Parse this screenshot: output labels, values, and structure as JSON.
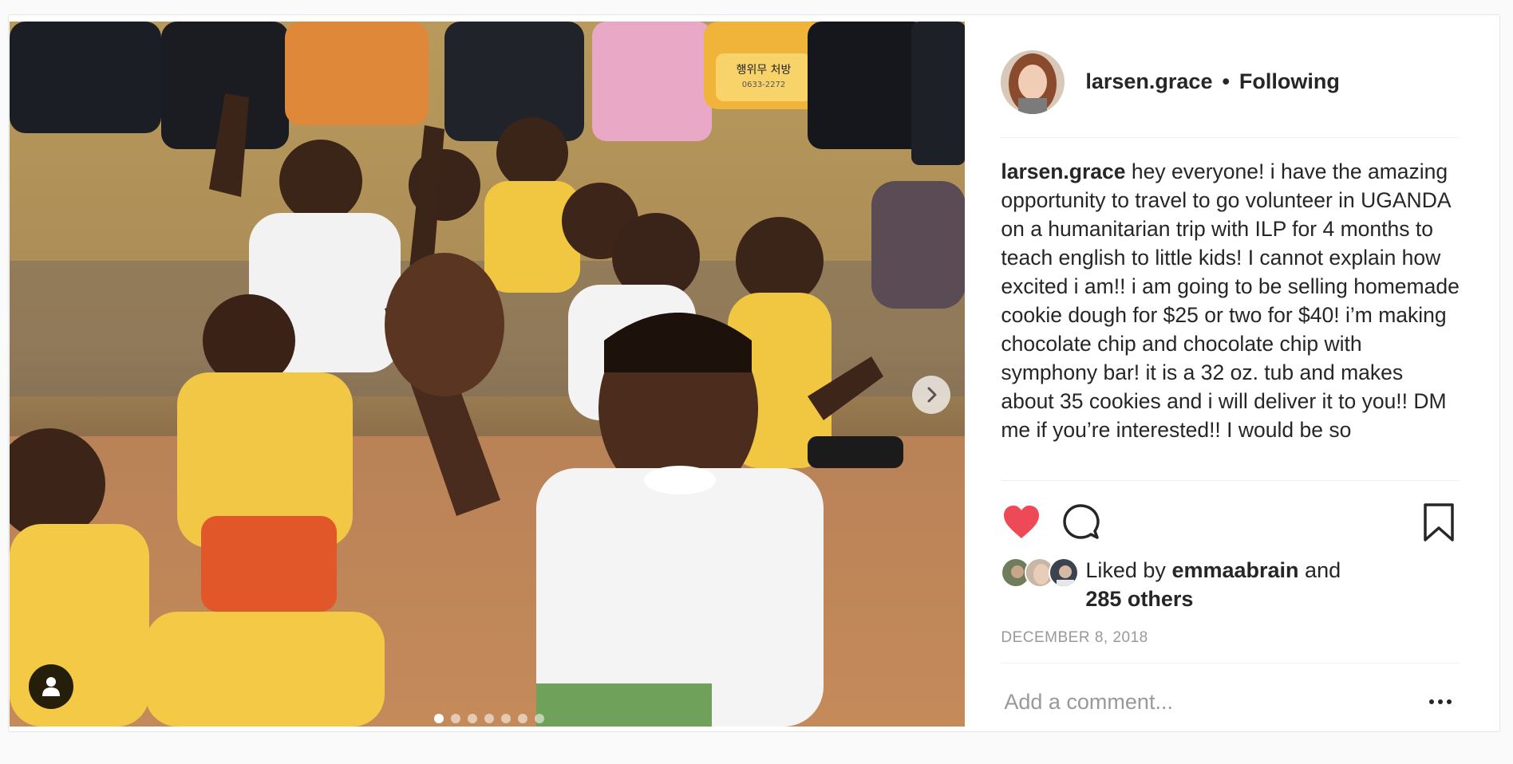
{
  "post": {
    "username": "larsen.grace",
    "separator": "•",
    "follow_status": "Following",
    "caption_text": "hey everyone! i have the amazing opportunity to travel to go volunteer in UGANDA on a humanitarian trip with ILP for 4 months to teach english to little kids! I cannot explain how excited i am!! i am going to be selling homemade cookie dough for $25 or two for $40! i’m making chocolate chip and chocolate chip with symphony bar! it is a 32 oz. tub and makes about 35 cookies and i will deliver it to you!! DM me if you’re interested!! I would be so",
    "liked_prefix": "Liked by",
    "liked_user": "emmaabrain",
    "liked_and": "and",
    "liked_others": "285 others",
    "date": "DECEMBER 8, 2018",
    "comment_placeholder": "Add a comment..."
  },
  "carousel": {
    "total": 7,
    "active_index": 0
  },
  "photo_text": {
    "backpack_label": "행위무 처방",
    "backpack_sub": "0633-2272"
  },
  "icons": {
    "like": "heart-filled-icon",
    "comment": "speech-bubble-icon",
    "save": "bookmark-icon",
    "next": "chevron-right-icon",
    "tag": "user-tag-icon",
    "more": "more-options-icon"
  },
  "colors": {
    "like_red": "#ed4956",
    "text": "#262626",
    "muted": "#999999",
    "divider": "#efefef"
  }
}
